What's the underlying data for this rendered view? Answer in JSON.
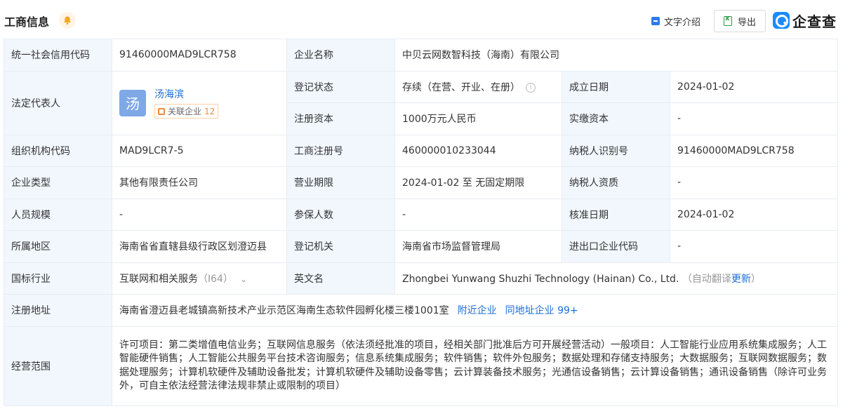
{
  "header": {
    "title": "工商信息",
    "text_intro_label": "文字介绍",
    "export_label": "导出",
    "logo_text": "企查查"
  },
  "rows": {
    "credit_code_label": "统一社会信用代码",
    "credit_code_value": "91460000MAD9LCR758",
    "company_name_label": "企业名称",
    "company_name_value": "中贝云网数智科技（海南）有限公司",
    "legal_rep_label": "法定代表人",
    "legal_rep_avatar": "汤",
    "legal_rep_name": "汤海滨",
    "related_company_label": "关联企业",
    "related_company_count": "12",
    "reg_status_label": "登记状态",
    "reg_status_value": "存续（在营、开业、在册）",
    "founded_label": "成立日期",
    "founded_value": "2024-01-02",
    "reg_capital_label": "注册资本",
    "reg_capital_value": "1000万元人民币",
    "paid_capital_label": "实缴资本",
    "paid_capital_value": "-",
    "org_code_label": "组织机构代码",
    "org_code_value": "MAD9LCR7-5",
    "biz_reg_no_label": "工商注册号",
    "biz_reg_no_value": "460000010233044",
    "taxpayer_id_label": "纳税人识别号",
    "taxpayer_id_value": "91460000MAD9LCR758",
    "company_type_label": "企业类型",
    "company_type_value": "其他有限责任公司",
    "biz_term_label": "营业期限",
    "biz_term_value": "2024-01-02 至 无固定期限",
    "taxpayer_qual_label": "纳税人资质",
    "taxpayer_qual_value": "-",
    "staff_size_label": "人员规模",
    "staff_size_value": "-",
    "insured_label": "参保人数",
    "insured_value": "-",
    "approval_date_label": "核准日期",
    "approval_date_value": "2024-01-02",
    "region_label": "所属地区",
    "region_value": "海南省省直辖县级行政区划澄迈县",
    "reg_authority_label": "登记机关",
    "reg_authority_value": "海南省市场监督管理局",
    "import_export_label": "进出口企业代码",
    "import_export_value": "-",
    "industry_label": "国标行业",
    "industry_value": "互联网和相关服务",
    "industry_code": "（I64）",
    "english_name_label": "英文名",
    "english_name_value": "Zhongbei Yunwang Shuzhi Technology (Hainan) Co., Ltd.",
    "auto_translate_prefix": "（自动翻译",
    "auto_translate_update": "更新",
    "auto_translate_suffix": "）",
    "address_label": "注册地址",
    "address_value": "海南省澄迈县老城镇高新技术产业示范区海南生态软件园孵化楼三楼1001室",
    "nearby_label": "附近企业",
    "same_address_label": "同地址企业 99+",
    "scope_label": "经营范围",
    "scope_value": "许可项目：第二类增值电信业务；互联网信息服务（依法须经批准的项目，经相关部门批准后方可开展经营活动）一般项目：人工智能行业应用系统集成服务；人工智能硬件销售；人工智能公共服务平台技术咨询服务；信息系统集成服务；软件销售；软件外包服务；数据处理和存储支持服务；大数据服务；互联网数据服务；数据处理服务；计算机软硬件及辅助设备批发；计算机软硬件及辅助设备零售；云计算装备技术服务；光通信设备销售；云计算设备销售；通讯设备销售（除许可业务外，可自主依法经营法律法规非禁止或限制的项目）"
  },
  "colors": {
    "label_bg": "#f2f7fe",
    "link": "#1b6ed8",
    "border": "#e8ecf2",
    "accent_orange": "#f08a3c"
  }
}
